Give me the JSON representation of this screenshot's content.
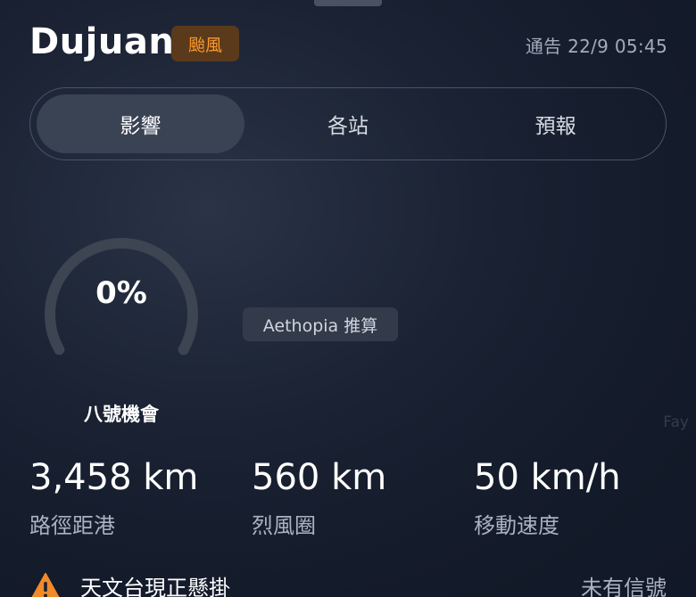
{
  "header": {
    "name": "Dujuan",
    "type_badge": "颱風",
    "bulletin_time": "通告 22/9 05:45"
  },
  "tabs": [
    {
      "label": "影響",
      "active": true
    },
    {
      "label": "各站",
      "active": false
    },
    {
      "label": "預報",
      "active": false
    }
  ],
  "gauge": {
    "value_text": "0%",
    "level": 0,
    "label": "八號機會"
  },
  "estimate_chip": "Aethopia 推算",
  "watermark": "Fay",
  "stats": [
    {
      "value": "3,458 km",
      "label": "路徑距港"
    },
    {
      "value": "560 km",
      "label": "烈風圈"
    },
    {
      "value": "50 km/h",
      "label": "移動速度"
    }
  ],
  "signal": {
    "icon": "warning-icon",
    "title": "天文台現正懸掛",
    "status": "未有信號"
  },
  "colors": {
    "badge_text": "#ff9a2e",
    "badge_bg": "#5a3a1a",
    "gauge_track": "#3d4452",
    "warning": "#f08a2a"
  }
}
